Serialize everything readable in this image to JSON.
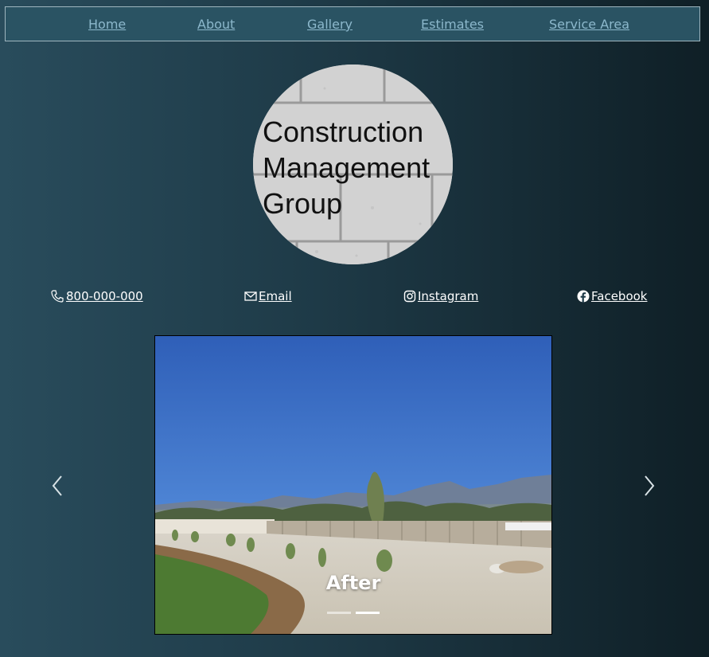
{
  "nav": {
    "items": [
      "Home",
      "About",
      "Gallery",
      "Estimates",
      "Service Area"
    ]
  },
  "logo": {
    "line1": "Construction",
    "line2": "Management",
    "line3": "Group"
  },
  "contact": {
    "phone": " 800-000-000",
    "email": " Email",
    "instagram": " Instagram",
    "facebook": " Facebook"
  },
  "carousel": {
    "caption": "After",
    "slide_count": 2,
    "active_slide": 2
  },
  "colors": {
    "nav_link": "#8cb8cc",
    "nav_bg": "#2a5363",
    "text": "#ffffff"
  }
}
